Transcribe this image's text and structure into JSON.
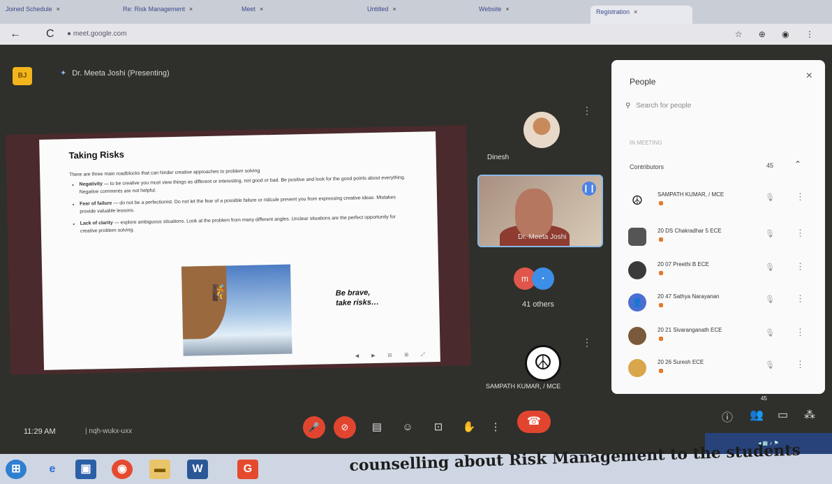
{
  "browser": {
    "tabs": [
      {
        "label": "Joined Schedule"
      },
      {
        "label": "Re: Risk Management"
      },
      {
        "label": "Meet"
      },
      {
        "label": "Untitled"
      },
      {
        "label": "Website"
      },
      {
        "label": "Registration"
      }
    ],
    "url": "meet.google.com"
  },
  "meet": {
    "presenter": "Dr. Meeta Joshi (Presenting)",
    "logo_text": "BJ",
    "slide": {
      "title": "Taking Risks",
      "intro": "There are three main roadblocks that can hinder creative approaches to problem solving",
      "bullets": [
        {
          "term": "Negativity",
          "text": " — to be creative you must view things as different or interesting, not good or bad. Be positive and look for the good points about everything. Negative comments are not helpful."
        },
        {
          "term": "Fear of failure",
          "text": " — do not be a perfectionist. Do not let the fear of a possible failure or ridicule prevent you from expressing creative ideas. Mistakes provide valuable lessons."
        },
        {
          "term": "Lack of clarity",
          "text": " — explore ambiguous situations. Look at the problem from many different angles. Unclear situations are the perfect opportunity for creative problem solving."
        }
      ],
      "caption_line1": "Be brave,",
      "caption_line2": "take risks…"
    },
    "tiles": {
      "dinesh": "Dinesh",
      "presenter_video": "Dr. Meeta Joshi",
      "others_label": "41 others",
      "sampath": "SAMPATH KUMAR, / MCE"
    },
    "people": {
      "title": "People",
      "search_placeholder": "Search for people",
      "section": "IN MEETING",
      "contributors_label": "Contributors",
      "contributors_count": "45",
      "list": [
        {
          "name": "SAMPATH KUMAR, / MCE",
          "avatar_color": "#ffffff"
        },
        {
          "name": "20 DS Chakradhar 5 ECE",
          "avatar_color": "#555555"
        },
        {
          "name": "20 07 Preethi B ECE",
          "avatar_color": "#3a3a3a"
        },
        {
          "name": "20 47 Sathya Narayanan",
          "avatar_color": "#4a6fd1"
        },
        {
          "name": "20 21 Sivaranganath ECE",
          "avatar_color": "#7a5a3a"
        },
        {
          "name": "20 26 Suresh ECE",
          "avatar_color": "#d9a64b"
        }
      ]
    },
    "bottom": {
      "time": "11:29 AM",
      "meeting_code": "nqh-wukx-uxx",
      "participants_badge": "45"
    }
  },
  "caption": "counselling about Risk Management to the students",
  "colors": {
    "accent": "#e2452f",
    "meet_bg": "#2f302b",
    "blue": "#4c82e6"
  }
}
